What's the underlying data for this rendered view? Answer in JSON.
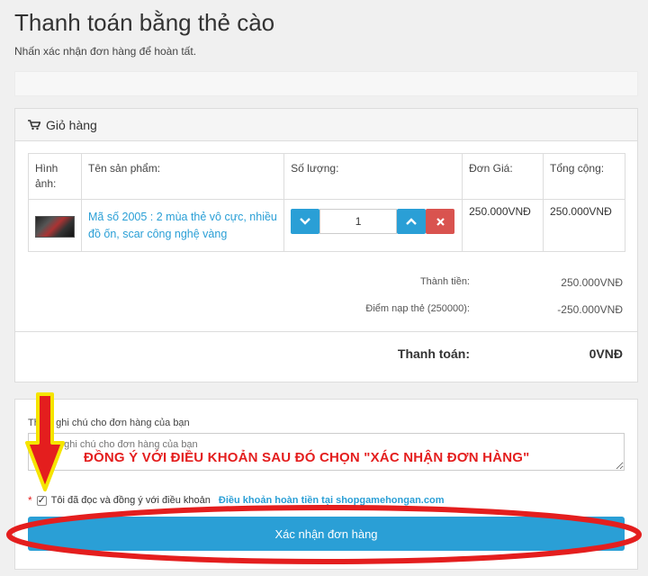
{
  "page": {
    "title": "Thanh toán bằng thẻ cào",
    "subtitle": "Nhấn xác nhận đơn hàng để hoàn tất."
  },
  "cart": {
    "heading": "Giỏ hàng",
    "icon": "shopping-cart-icon",
    "columns": [
      "Hình ảnh:",
      "Tên sản phẩm:",
      "Số lượng:",
      "Đơn Giá:",
      "Tổng cộng:"
    ],
    "items": [
      {
        "name": "Mã số 2005 : 2 mùa thẻ vô cực, nhiều đồ ốn, scar công nghệ vàng",
        "quantity": "1",
        "unit_price": "250.000VNĐ",
        "total": "250.000VNĐ"
      }
    ],
    "summary": {
      "subtotal_label": "Thành tiền:",
      "subtotal_value": "250.000VNĐ",
      "points_label": "Điểm nạp thẻ (250000):",
      "points_value": "-250.000VNĐ",
      "total_label": "Thanh toán:",
      "total_value": "0VNĐ"
    }
  },
  "checkout": {
    "note_label": "Thêm ghi chú cho đơn hàng của bạn",
    "note_placeholder": "Thêm ghi chú cho đơn hàng của bạn",
    "annotation_text": "ĐỒNG Ý VỚI ĐIỀU KHOẢN SAU ĐÓ CHỌN \"XÁC NHẬN ĐƠN HÀNG\"",
    "agree_required_mark": "*",
    "agree_text": "Tôi đã đọc và đồng ý với điều khoản",
    "agree_checked": true,
    "terms_link": "Điều khoản hoàn tiền tại shopgamehongan.com",
    "confirm_label": "Xác nhận đơn hàng"
  },
  "colors": {
    "accent": "#2a9fd6",
    "danger": "#d9534f",
    "annotation_red": "#e41e1e",
    "annotation_yellow": "#f5e400"
  }
}
